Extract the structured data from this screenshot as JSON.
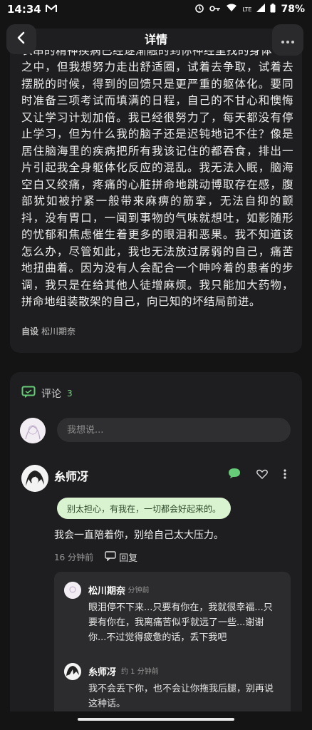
{
  "status_bar": {
    "time": "14:34",
    "battery": "78%",
    "network": "LTE"
  },
  "header": {
    "title": "详情"
  },
  "post": {
    "cut_line": "长串的精神疾病已经逐渐融的到你神经里找的身体",
    "body": "之中，但我想努力走出舒适圈，试着去争取，试着去摆脱的时候，得到的回馈只是更严重的躯体化。要同时准备三项考试而填满的日程，自己的不甘心和懊悔又让学习计划加倍。我已经很努力了，每天都没有停止学习，但为什么我的脑子还是迟钝地记不住？像是居住脑海里的疾病把所有我该记住的都吞食，排出一片引起我全身躯体化反应的混乱。我无法入眠，脑海空白又绞痛，疼痛的心脏拼命地跳动博取存在感，腹部犹如被拧紧一般带来麻痹的筋挛，无法自抑的颤抖，没有胃口，一闻到事物的气味就想吐，如影随形的忧郁和焦虑催生着更多的眼泪和恶果。我不知道该怎么办，尽管如此，我也无法放过孱弱的自己，痛苦地扭曲着。因为没有人会配合一个呻吟着的患者的步调，我只是在给其他人徒增麻烦。我只能加大药物，拼命地组装散架的自己，向已知的坏结局前进。",
    "tag_label": "自设",
    "tag_value": "松川期奈"
  },
  "comments": {
    "label": "评论",
    "count": "3",
    "input_placeholder": "我想说...",
    "items": [
      {
        "user": "糸师冴",
        "bubble": "别太担心，有我在，一切都会好起来的。",
        "text": "我会一直陪着你，别给自己太大压力。",
        "time": "16 分钟前",
        "reply_label": "回复",
        "replies": [
          {
            "user": "松川期奈",
            "time": "2 分钟前",
            "text": "眼泪停不下来...只要有你在，我就很幸福...只要有你在，我离痛苦似乎就远了一些...谢谢你...不过觉得疲惫的话，丢下我吧"
          },
          {
            "user": "糸师冴",
            "time": "约 1 分钟前",
            "text": "我不会丢下你，也不会让你拖我后腿，别再说这种话。"
          }
        ]
      }
    ]
  },
  "colors": {
    "accent": "#66cc77",
    "bubble_bg": "#d9f2cf",
    "card_bg": "#1e1e20",
    "page_bg": "#141414"
  }
}
